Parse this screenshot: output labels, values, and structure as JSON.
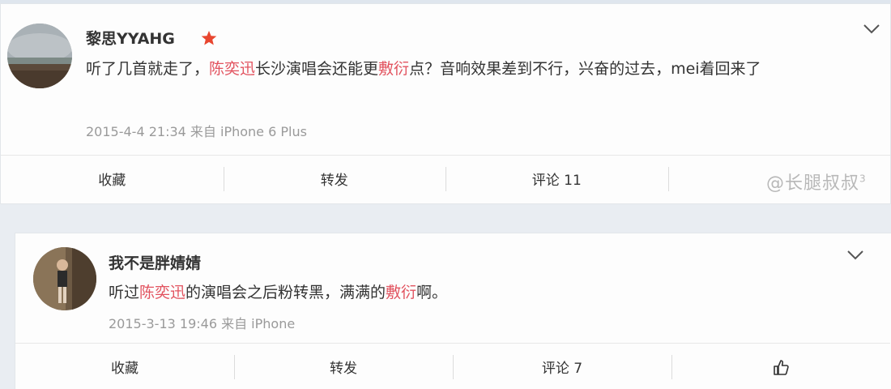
{
  "posts": [
    {
      "username": "黎思YYAHG",
      "content": {
        "p1": "听了几首就走了，",
        "h1": "陈奕迅",
        "p2": "长沙演唱会还能更",
        "h2": "敷衍",
        "p3": "点？音响效果差到不行，兴奋的过去，mei着回来了"
      },
      "meta": "2015-4-4 21:34 来自 iPhone 6 Plus",
      "actions": [
        "收藏",
        "转发",
        "评论 11"
      ]
    },
    {
      "username": "我不是胖婧婧",
      "content": {
        "p1": "听过",
        "h1": "陈奕迅",
        "p2": "的演唱会之后粉转黑，满满的",
        "h2": "敷衍",
        "p3": "啊。"
      },
      "meta": "2015-3-13 19:46 来自 iPhone",
      "actions": [
        "收藏",
        "转发",
        "评论 7"
      ]
    }
  ],
  "colors": {
    "highlight": "#e2535f",
    "meta_text": "#9a9a9a",
    "vip_star": "#e8462f"
  },
  "icons": {
    "vip": "red-star-icon",
    "menu": "chevron-down-icon",
    "like": "thumbs-up-icon"
  },
  "watermark": {
    "text": "@长腿叔叔",
    "superscript": "3"
  }
}
